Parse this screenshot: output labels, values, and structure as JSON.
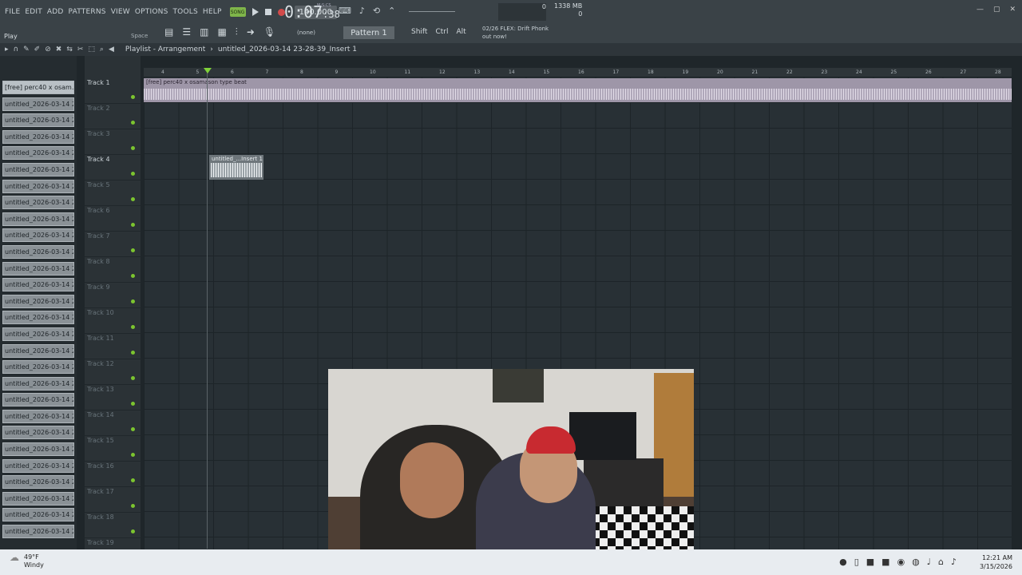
{
  "menu": [
    "FILE",
    "EDIT",
    "ADD",
    "PATTERNS",
    "VIEW",
    "OPTIONS",
    "TOOLS",
    "HELP"
  ],
  "song_mode": "SONG",
  "tempo": "140.000",
  "time": {
    "main": "0:07",
    "sub": ":38",
    "label": "M:S:CS"
  },
  "memory": {
    "value1": "1338 MB",
    "value2": "0",
    "cpu": "0"
  },
  "hint": {
    "action": "Play",
    "shortcut": "Space"
  },
  "pattern": {
    "none": "(none)",
    "name": "Pattern 1"
  },
  "modifiers": [
    "Shift",
    "Ctrl",
    "Alt"
  ],
  "news": {
    "counter": "02/26",
    "line1": "FLEX: Drift Phonk",
    "line2": "out now!"
  },
  "playlist": {
    "title": "Playlist - Arrangement",
    "crumb": "untitled_2026-03-14 23-28-39_Insert 1"
  },
  "ruler": [
    "4",
    "5",
    "6",
    "7",
    "8",
    "9",
    "10",
    "11",
    "12",
    "13",
    "14",
    "15",
    "16",
    "17",
    "18",
    "19",
    "20",
    "21",
    "22",
    "23",
    "24",
    "25",
    "26",
    "27",
    "28"
  ],
  "channels": [
    "[free] perc40 x osam...",
    "untitled_2026-03-14 22-...",
    "untitled_2026-03-14 22-...",
    "untitled_2026-03-14 22-...",
    "untitled_2026-03-14 22-...",
    "untitled_2026-03-14 22-...",
    "untitled_2026-03-14 22-...",
    "untitled_2026-03-14 22-...",
    "untitled_2026-03-14 22-...",
    "untitled_2026-03-14 22-...",
    "untitled_2026-03-14 22-...",
    "untitled_2026-03-14 22-...",
    "untitled_2026-03-14 22-...",
    "untitled_2026-03-14 22-...",
    "untitled_2026-03-14 22-...",
    "untitled_2026-03-14 22-...",
    "untitled_2026-03-14 22-...",
    "untitled_2026-03-14 22-...",
    "untitled_2026-03-14 22-...",
    "untitled_2026-03-14 22-...",
    "untitled_2026-03-14 22-...",
    "untitled_2026-03-14 22-...",
    "untitled_2026-03-14 22-...",
    "untitled_2026-03-14 22-...",
    "untitled_2026-03-14 22-...",
    "untitled_2026-03-14 22-...",
    "untitled_2026-03-14 22-...",
    "untitled_2026-03-14 22-..."
  ],
  "tracks": [
    "Track 1",
    "Track 2",
    "Track 3",
    "Track 4",
    "Track 5",
    "Track 6",
    "Track 7",
    "Track 8",
    "Track 9",
    "Track 10",
    "Track 11",
    "Track 12",
    "Track 13",
    "Track 14",
    "Track 15",
    "Track 16",
    "Track 17",
    "Track 18",
    "Track 19"
  ],
  "clips": {
    "clip1": "[free] perc40 x osamason type beat",
    "clip2": "untitled_...Insert 1"
  },
  "taskbar": {
    "weather_temp": "49°F",
    "weather_desc": "Windy",
    "time": "12:21 AM",
    "date": "3/15/2026"
  }
}
